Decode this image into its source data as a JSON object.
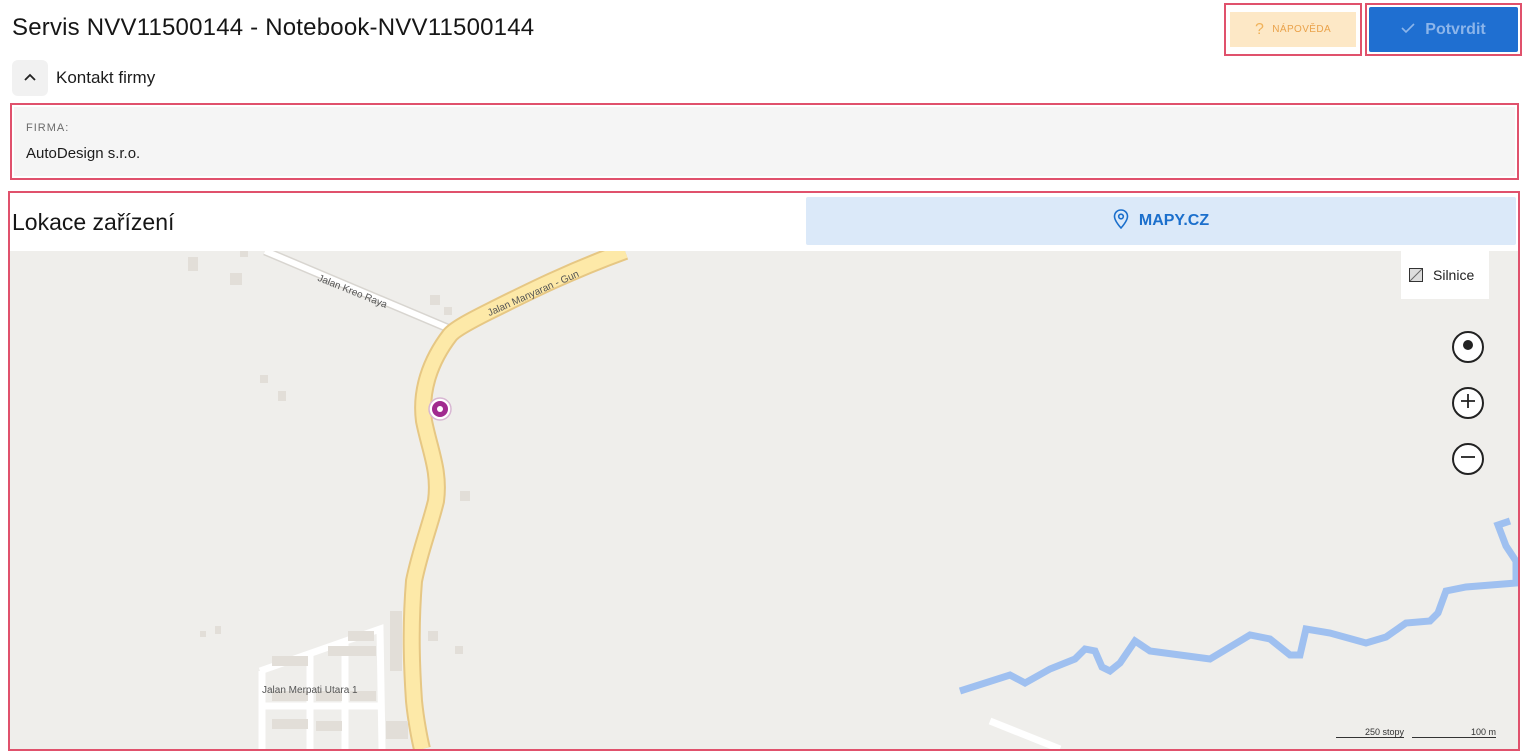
{
  "header": {
    "title": "Servis NVV11500144 - Notebook-NVV11500144",
    "help_label": "NÁPOVĚDA",
    "confirm_label": "Potvrdit"
  },
  "contact_section": {
    "toggle_label": "Kontakt firmy",
    "firm_label": "FIRMA:",
    "firm_value": "AutoDesign s.r.o."
  },
  "location_section": {
    "title": "Lokace zařízení",
    "mapy_button_label": "MAPY.CZ"
  },
  "map": {
    "layer_label": "Silnice",
    "street_labels": {
      "kreo_raya": "Jalan Kreo Raya",
      "manyaran": "Jalan Manyaran - Gun",
      "merpati": "Jalan Merpati Utara 1"
    },
    "scale_imperial": "250 stopy",
    "scale_metric": "100 m"
  },
  "colors": {
    "accent_red": "#e0516c",
    "primary_blue": "#1f6fd1",
    "help_bg": "#fde8c6",
    "map_bg": "#efeeeb",
    "road_yellow": "#fde9a8",
    "river_blue": "#9fc0f0",
    "marker_purple": "#a12a8f"
  },
  "icons": {
    "help": "question-icon",
    "confirm": "check-icon",
    "toggle": "chevron-up-icon",
    "mapy": "map-pin-icon",
    "layer": "road-layer-icon",
    "locate": "target-icon",
    "zoom_in": "plus-icon",
    "zoom_out": "minus-icon"
  }
}
